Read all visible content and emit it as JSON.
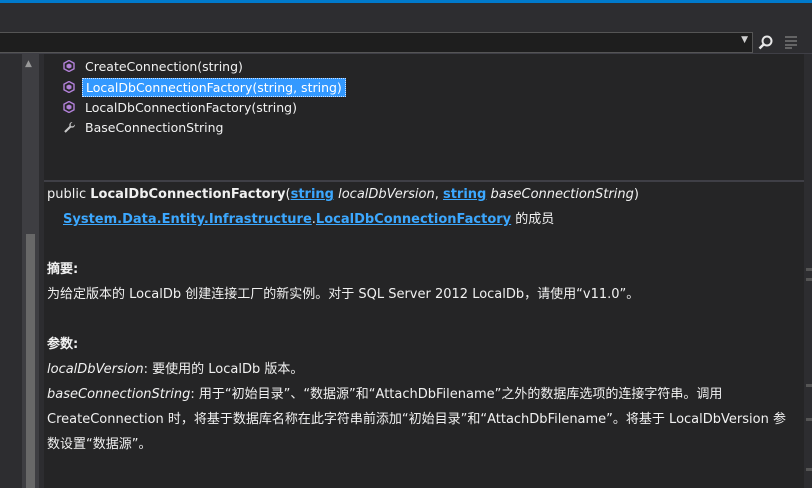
{
  "colors": {
    "accent": "#007acc",
    "selection": "#3399ff",
    "link": "#3ca8ff",
    "method_icon": "#b180d7",
    "wrench_icon": "#c8c8c8"
  },
  "members": [
    {
      "label": "CreateConnection(string)",
      "icon": "method-icon",
      "selected": false
    },
    {
      "label": "LocalDbConnectionFactory(string, string)",
      "icon": "method-icon",
      "selected": true
    },
    {
      "label": "LocalDbConnectionFactory(string)",
      "icon": "method-icon",
      "selected": false
    },
    {
      "label": "BaseConnectionString",
      "icon": "wrench-icon",
      "selected": false
    }
  ],
  "detail": {
    "sig_prefix": "public ",
    "sig_name": "LocalDbConnectionFactory",
    "sig_open": "(",
    "param1_type": "string",
    "param1_name": " localDbVersion",
    "comma": ", ",
    "param2_type": "string",
    "param2_name": " baseConnectionString",
    "sig_close": ")",
    "ns1": "System.Data.Entity.Infrastructure",
    "ns_dot": ".",
    "ns2": "LocalDbConnectionFactory",
    "member_of": " 的成员",
    "summary_heading": "摘要:",
    "summary_text": "为给定版本的 LocalDb 创建连接工厂的新实例。对于 SQL Server 2012 LocalDb，请使用“v11.0”。",
    "params_heading": "参数:",
    "p1_name": "localDbVersion",
    "p1_desc": ": 要使用的 LocalDb 版本。",
    "p2_name": "baseConnectionString",
    "p2_desc_1": ": 用于“初始目录”、“数据源”和“AttachDbFilename”之外的数据库选项的连接字符串。调用",
    "p2_desc_2": "CreateConnection 时，将基于数据库名称在此字符串前添加“初始目录”和“AttachDbFilename”。将基于 LocalDbVersion 参",
    "p2_desc_3": "数设置“数据源”。"
  }
}
